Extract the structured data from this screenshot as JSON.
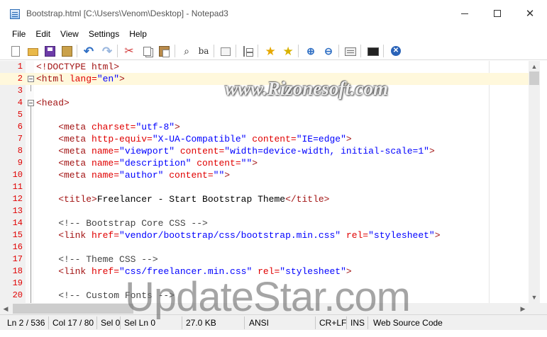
{
  "window": {
    "title": "Bootstrap.html [C:\\Users\\Venom\\Desktop] - Notepad3",
    "minimize_icon": "minimize-icon",
    "maximize_icon": "maximize-icon",
    "close_glyph": "✕"
  },
  "menu": [
    "File",
    "Edit",
    "View",
    "Settings",
    "Help"
  ],
  "toolbar": {
    "icons": [
      "new-file-icon",
      "open-folder-icon",
      "save-icon",
      "save-as-icon",
      "undo-icon",
      "redo-icon",
      "cut-icon",
      "copy-icon",
      "paste-icon",
      "find-icon",
      "replace-icon",
      "word-wrap-icon",
      "tree-view-icon",
      "favorite-star-icon",
      "add-favorite-icon",
      "zoom-in-icon",
      "zoom-out-icon",
      "settings-icon",
      "screen-icon",
      "exit-icon"
    ]
  },
  "editor": {
    "current_line": 2,
    "lines": [
      {
        "n": "1",
        "fold": false
      },
      {
        "n": "2",
        "fold": true
      },
      {
        "n": "3",
        "fold": false
      },
      {
        "n": "4",
        "fold": true
      },
      {
        "n": "5",
        "fold": false
      },
      {
        "n": "6",
        "fold": false
      },
      {
        "n": "7",
        "fold": false
      },
      {
        "n": "8",
        "fold": false
      },
      {
        "n": "9",
        "fold": false
      },
      {
        "n": "10",
        "fold": false
      },
      {
        "n": "11",
        "fold": false
      },
      {
        "n": "12",
        "fold": false
      },
      {
        "n": "13",
        "fold": false
      },
      {
        "n": "14",
        "fold": false
      },
      {
        "n": "15",
        "fold": false
      },
      {
        "n": "16",
        "fold": false
      },
      {
        "n": "17",
        "fold": false
      },
      {
        "n": "18",
        "fold": false
      },
      {
        "n": "19",
        "fold": false
      },
      {
        "n": "20",
        "fold": false
      }
    ],
    "code": {
      "l1": "<!DOCTYPE html>",
      "l2a": "<html ",
      "l2b": "lang=",
      "l2c": "\"en\"",
      "l2d": ">",
      "l4": "<head>",
      "l6a": "    <meta ",
      "l6b": "charset=",
      "l6c": "\"utf-8\"",
      "l6d": ">",
      "l7a": "    <meta ",
      "l7b": "http-equiv=",
      "l7c": "\"X-UA-Compatible\" ",
      "l7d": "content=",
      "l7e": "\"IE=edge\"",
      "l7f": ">",
      "l8a": "    <meta ",
      "l8b": "name=",
      "l8c": "\"viewport\" ",
      "l8d": "content=",
      "l8e": "\"width=device-width, initial-scale=1\"",
      "l8f": ">",
      "l9a": "    <meta ",
      "l9b": "name=",
      "l9c": "\"description\" ",
      "l9d": "content=",
      "l9e": "\"\"",
      "l9f": ">",
      "l10a": "    <meta ",
      "l10b": "name=",
      "l10c": "\"author\" ",
      "l10d": "content=",
      "l10e": "\"\"",
      "l10f": ">",
      "l12a": "    <title>",
      "l12b": "Freelancer - Start Bootstrap Theme",
      "l12c": "</title>",
      "l14": "    <!-- Bootstrap Core CSS -->",
      "l15a": "    <link ",
      "l15b": "href=",
      "l15c": "\"vendor/bootstrap/css/bootstrap.min.css\" ",
      "l15d": "rel=",
      "l15e": "\"stylesheet\"",
      "l15f": ">",
      "l17": "    <!-- Theme CSS -->",
      "l18a": "    <link ",
      "l18b": "href=",
      "l18c": "\"css/freelancer.min.css\" ",
      "l18d": "rel=",
      "l18e": "\"stylesheet\"",
      "l18f": ">",
      "l20": "    <!-- Custom Fonts -->"
    }
  },
  "status": {
    "position": "Ln 2 / 536",
    "column": "Col 17 / 80",
    "selection": "Sel 0",
    "sel_lines": "Sel Ln 0",
    "size": "27.0 KB",
    "encoding": "ANSI",
    "eol": "CR+LF",
    "mode": "INS",
    "lexer": "Web Source Code"
  },
  "watermarks": {
    "top": "www.Rizonesoft.com",
    "bottom": "UpdateStar.com"
  }
}
